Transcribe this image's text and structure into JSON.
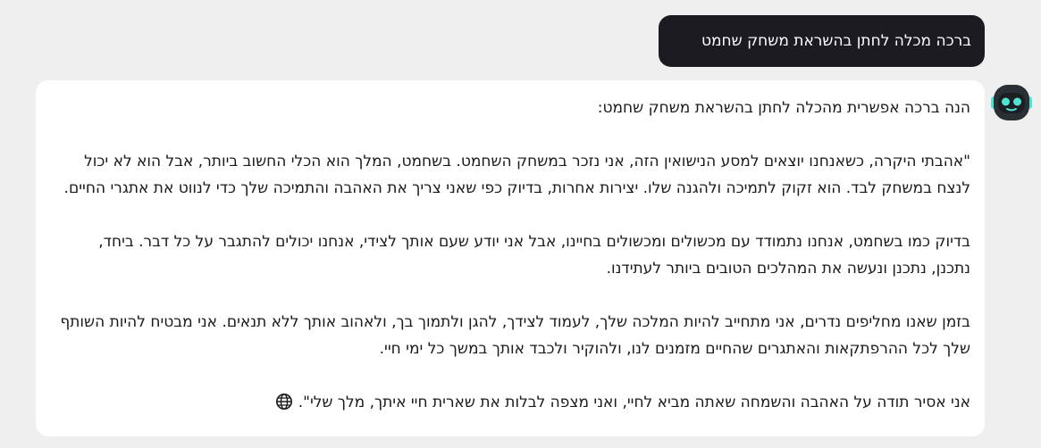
{
  "conversation": {
    "user_message": "ברכה מכלה לחתן בהשראת משחק שחמט",
    "assistant": {
      "avatar_icon": "robot-avatar-icon",
      "intro": "הנה ברכה אפשרית מהכלה לחתן בהשראת משחק שחמט:",
      "paragraph_1": "\"אהבתי היקרה, כשאנחנו יוצאים למסע הנישואין הזה, אני נזכר במשחק השחמט. בשחמט, המלך הוא הכלי החשוב ביותר, אבל הוא לא יכול לנצח במשחק לבד. הוא זקוק לתמיכה ולהגנה שלו. יצירות אחרות, בדיוק כפי שאני צריך את האהבה והתמיכה שלך כדי לנווט את אתגרי החיים.",
      "paragraph_2": "בדיוק כמו בשחמט, אנחנו נתמודד עם מכשולים ומכשולים בחיינו, אבל אני יודע שעם אותך לצידי, אנחנו יכולים להתגבר על כל דבר. ביחד, נתכנן, נתכנן ונעשה את המהלכים הטובים ביותר לעתידנו.",
      "paragraph_3": "בזמן שאנו מחליפים נדרים, אני מתחייב להיות המלכה שלך, לעמוד לצידך, להגן ולתמוך בך, ולאהוב אותך ללא תנאים. אני מבטיח להיות השותף שלך לכל ההרפתקאות והאתגרים שהחיים מזמנים לנו, ולהוקיר ולכבד אותך במשך כל ימי חיי.",
      "paragraph_4": "אני אסיר תודה על האהבה והשמחה שאתה מביא לחיי, ואני מצפה לבלות את שארית חיי איתך, מלך שלי\".",
      "globe_icon": "globe-icon"
    }
  },
  "colors": {
    "background": "#efefef",
    "user_bubble": "#1c1b22",
    "assistant_bubble": "#ffffff",
    "avatar_accent": "#4fe3d0"
  }
}
